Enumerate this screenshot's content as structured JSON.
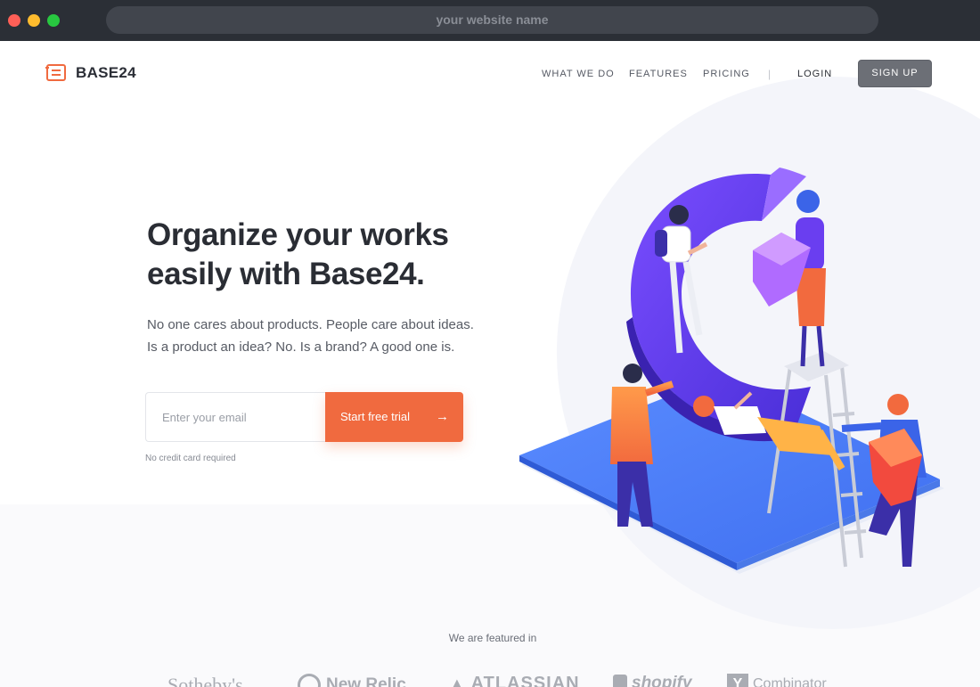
{
  "browser": {
    "url_text": "your website name"
  },
  "nav": {
    "logo_text": "BASE24",
    "links": [
      "WHAT WE DO",
      "FEATURES",
      "PRICING"
    ],
    "separator": "|",
    "login": "LOGIN",
    "signup": "SIGN UP"
  },
  "hero": {
    "title_line1": "Organize your works",
    "title_line2": "easily with Base24.",
    "sub_line1": "No one cares about products. People care about ideas.",
    "sub_line2": "Is a product an idea? No. Is a brand? A good one is.",
    "email_placeholder": "Enter your email",
    "cta": "Start free trial",
    "cta_arrow": "→",
    "note": "No credit card required"
  },
  "featured": {
    "label": "We are featured in",
    "brands": [
      "Sotheby's",
      "New Relic",
      "ATLASSIAN",
      "shopify",
      "Combinator"
    ]
  },
  "colors": {
    "accent": "#f06a3f",
    "signup_bg": "#6c6f76",
    "text_dark": "#2a2d34",
    "illustration_purple": "#6a3ef0",
    "illustration_blue": "#3f7ef0"
  }
}
